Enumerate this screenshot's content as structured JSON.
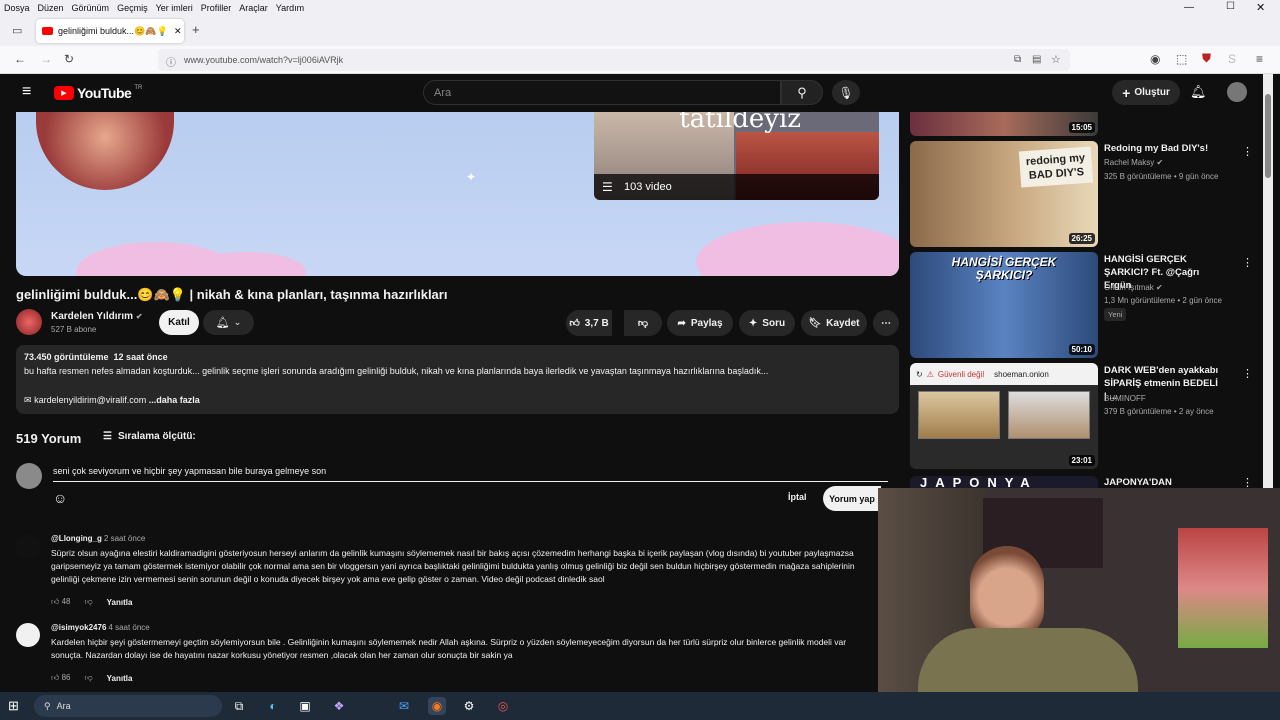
{
  "menubar": [
    "Dosya",
    "Düzen",
    "Görünüm",
    "Geçmiş",
    "Yer imleri",
    "Profiller",
    "Araçlar",
    "Yardım"
  ],
  "tab": {
    "title": "gelinliğimi bulduk...😊🙈💡 | nik"
  },
  "address": {
    "url": "www.youtube.com/watch?v=lj006iAVRjk"
  },
  "youtube": {
    "logo": "YouTube",
    "logo_suffix": "TR",
    "search_placeholder": "Ara",
    "create_label": "Oluştur"
  },
  "video": {
    "endcard_title": "tatildeyiz",
    "endcard_label": "103 video",
    "title": "gelinliğimi bulduk...😊🙈💡 | nikah & kına planları, taşınma hazırlıkları",
    "channel": "Kardelen Yıldırım",
    "subscribers": "527 B abone",
    "join_label": "Katıl",
    "likes": "3,7 B",
    "share_label": "Paylaş",
    "ask_label": "Soru",
    "save_label": "Kaydet"
  },
  "description": {
    "views": "73.450 görüntüleme",
    "time": "12 saat önce",
    "text": "bu hafta resmen nefes almadan koşturduk... gelinlik seçme işleri sonunda aradığım gelinliği bulduk, nikah ve kına planlarında baya ilerledik ve yavaştan taşınmaya hazırlıklarına başladık...",
    "email": "kardelenyildirim@viralif.com",
    "more": "...daha fazla"
  },
  "comments": {
    "count": "519 Yorum",
    "sort_label": "Sıralama ölçütü:",
    "draft": "seni çok seviyorum ve hiçbir şey yapmasan bile buraya gelmeye son",
    "cancel": "İptal",
    "submit": "Yorum yap",
    "reply_label": "Yanıtla",
    "items": [
      {
        "author": "@Llonging_g",
        "time": "2 saat önce",
        "text": "Süpriz olsun ayağına elestiri kaldiramadigini gösteriyosun herseyi anlarım da gelinlik kumaşını söylememek nasıl bir bakış açısı çözemedim herhangi başka bi içerik paylaşan (vlog dısında) bi youtuber paylaşmazsa garipsemeyiz ya tamam göstermek istemiyor olabilir çok normal ama sen bir vloggersın yani ayrıca başlıktaki gelinliğimi buldukta yanlış olmuş gelinliği biz değil sen buldun hiçbirşey göstermedin mağaza sahiplerinin gelinliği çekmene izin vermemesi senin sorunun değil o konuda diyecek birşey yok ama eve gelip göster o zaman. Video değil podcast dinledik saol",
        "likes": "48"
      },
      {
        "author": "@isimyok2476",
        "time": "4 saat önce",
        "text": "Kardelen hiçbir şeyi göstermemeyi geçtim söylemiyorsun bile . Gelinliğinin kumaşını söylememek nedir Allah aşkına. Sürpriz o yüzden söylemeyeceğim diyorsun da her türlü sürpriz olur binlerce gelinlik modeli var sonuçta. Nazardan dolayı ise de hayatını nazar korkusu yönetiyor resmen ,olacak olan her zaman olur sonuçta bir sakin ya",
        "likes": "86"
      }
    ]
  },
  "sidebar": [
    {
      "duration": "15:05"
    },
    {
      "title": "Redoing my Bad DIY's!",
      "channel": "Rachel Maksy",
      "meta": "325 B görüntüleme • 9 gün önce",
      "duration": "26:25",
      "thumb_text": "redoing my BAD DIY'S"
    },
    {
      "title": "HANGİSİ GERÇEK ŞARKICI? Ft. @Çağrı Ergün",
      "channel": "Orkun Işıtmak",
      "meta": "1,3 Mn görüntüleme • 2 gün önce",
      "badge": "Yeni",
      "duration": "50:10",
      "thumb_text": "HANGİSİ GERÇEK ŞARKICI?"
    },
    {
      "title": "DARK WEB'den ayakkabı SİPARİŞ etmenin BEDELİ | ...",
      "channel": "BUMINOFF",
      "meta": "379 B görüntüleme • 2 ay önce",
      "duration": "23:01",
      "thumb_warning": "Güvenli değil",
      "thumb_url": "shoeman.onion"
    },
    {
      "title": "JAPONYA'DAN ALDIKLARIM |",
      "thumb_text": "JAPONYA"
    }
  ],
  "taskbar": {
    "search": "Ara"
  },
  "colors": {
    "accent_red": "#ff0000",
    "bg": "#0f0f0f",
    "chip": "#272727"
  }
}
